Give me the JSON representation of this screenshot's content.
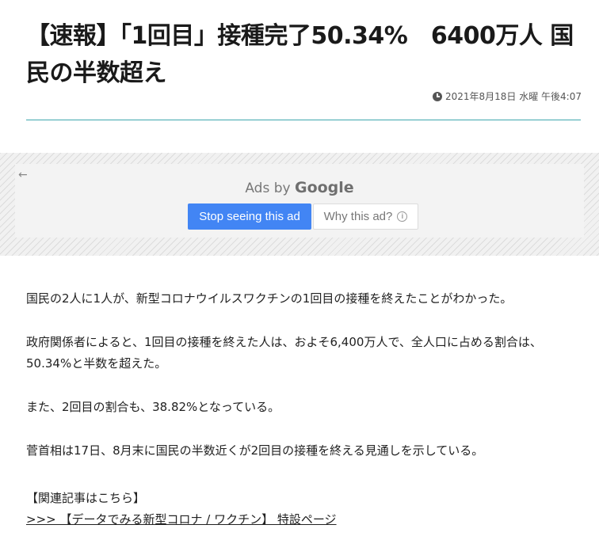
{
  "article": {
    "title": "【速報】「1回目」接種完了50.34%　6400万人 国民の半数超え",
    "date": "2021年8月18日 水曜 午後4:07"
  },
  "ad": {
    "back_icon": "arrow-left-icon",
    "ads_by": "Ads by",
    "brand": "Google",
    "stop_label": "Stop seeing this ad",
    "why_label": "Why this ad?",
    "info_icon": "info-icon"
  },
  "body": {
    "paragraphs": [
      "国民の2人に1人が、新型コロナウイルスワクチンの1回目の接種を終えたことがわかった。",
      "政府関係者によると、1回目の接種を終えた人は、およそ6,400万人で、全人口に占める割合は、50.34%と半数を超えた。",
      "また、2回目の割合も、38.82%となっている。",
      "菅首相は17日、8月末に国民の半数近くが2回目の接種を終える見通しを示している。"
    ],
    "related_label": "【関連記事はこちら】",
    "related_link": ">>> 【データでみる新型コロナ / ワクチン】 特設ページ"
  },
  "colors": {
    "accent_rule": "#3fa7ad",
    "ad_button": "#4285f4"
  }
}
